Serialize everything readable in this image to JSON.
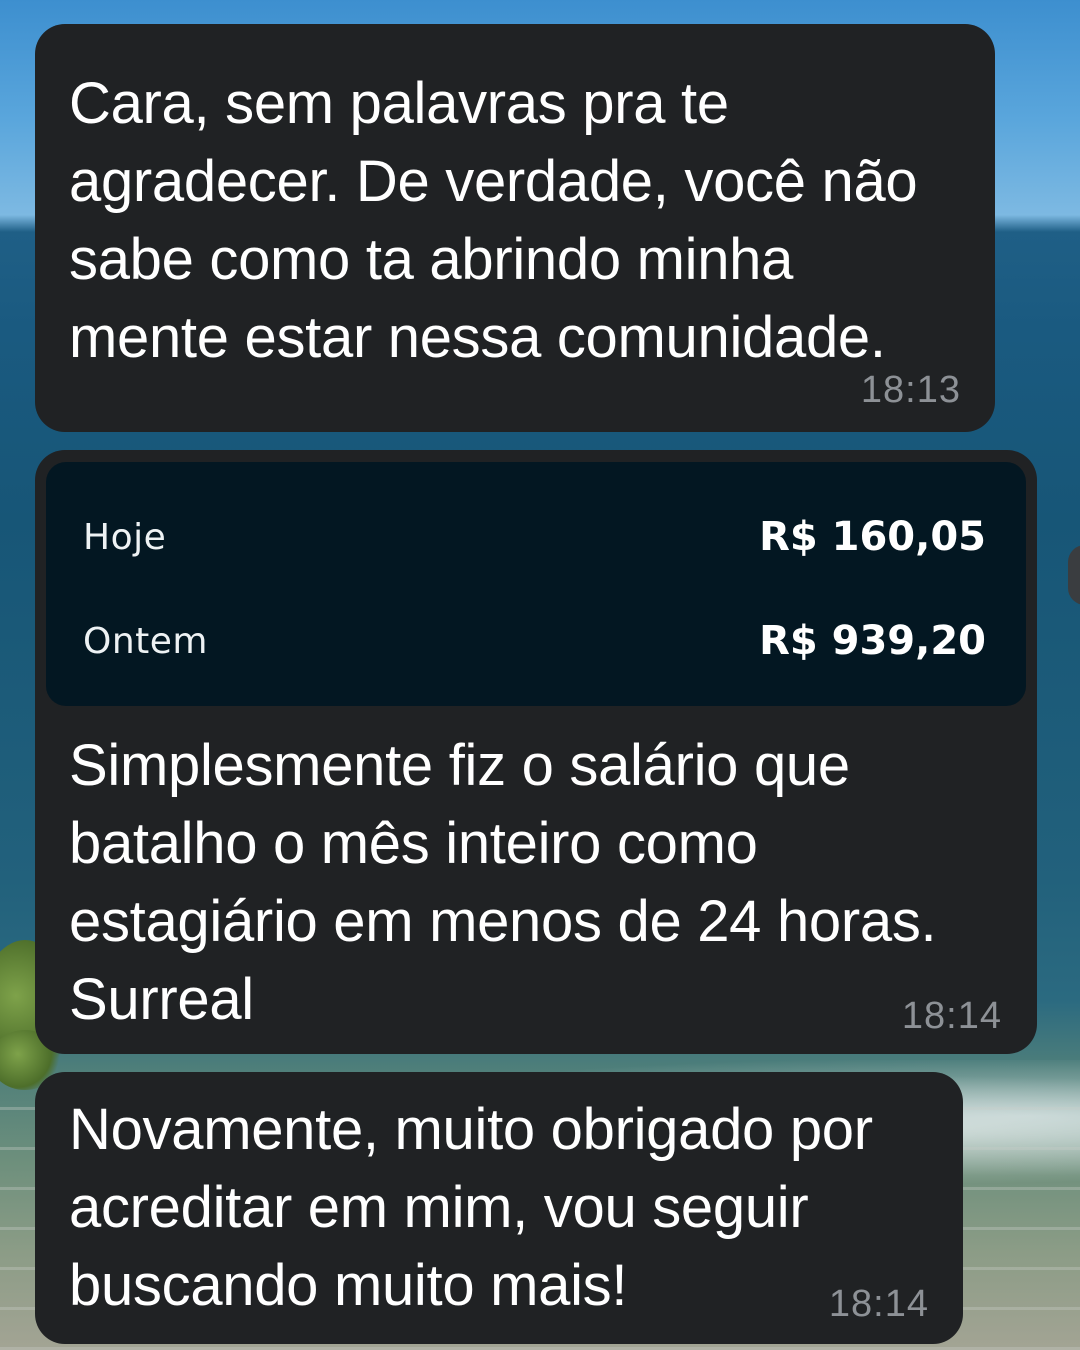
{
  "messages": [
    {
      "text": "Cara, sem palavras pra te\nagradecer. De verdade, você não\nsabe como ta abrindo minha\nmente estar nessa comunidade.",
      "time": "18:13"
    },
    {
      "earnings": [
        {
          "label": "Hoje",
          "value": "R$ 160,05"
        },
        {
          "label": "Ontem",
          "value": "R$ 939,20"
        }
      ],
      "text": "Simplesmente fiz o salário que\nbatalho o mês inteiro como\nestagiário em menos de 24 horas.\nSurreal",
      "time": "18:14"
    },
    {
      "text": "Novamente, muito obrigado por\nacreditar em mim, vou seguir\nbuscando muito mais!",
      "time": "18:14"
    }
  ],
  "colors": {
    "bubble": "#202224",
    "earnings_card": "#031722",
    "timestamp": "#8d9196",
    "text": "#ffffff"
  }
}
